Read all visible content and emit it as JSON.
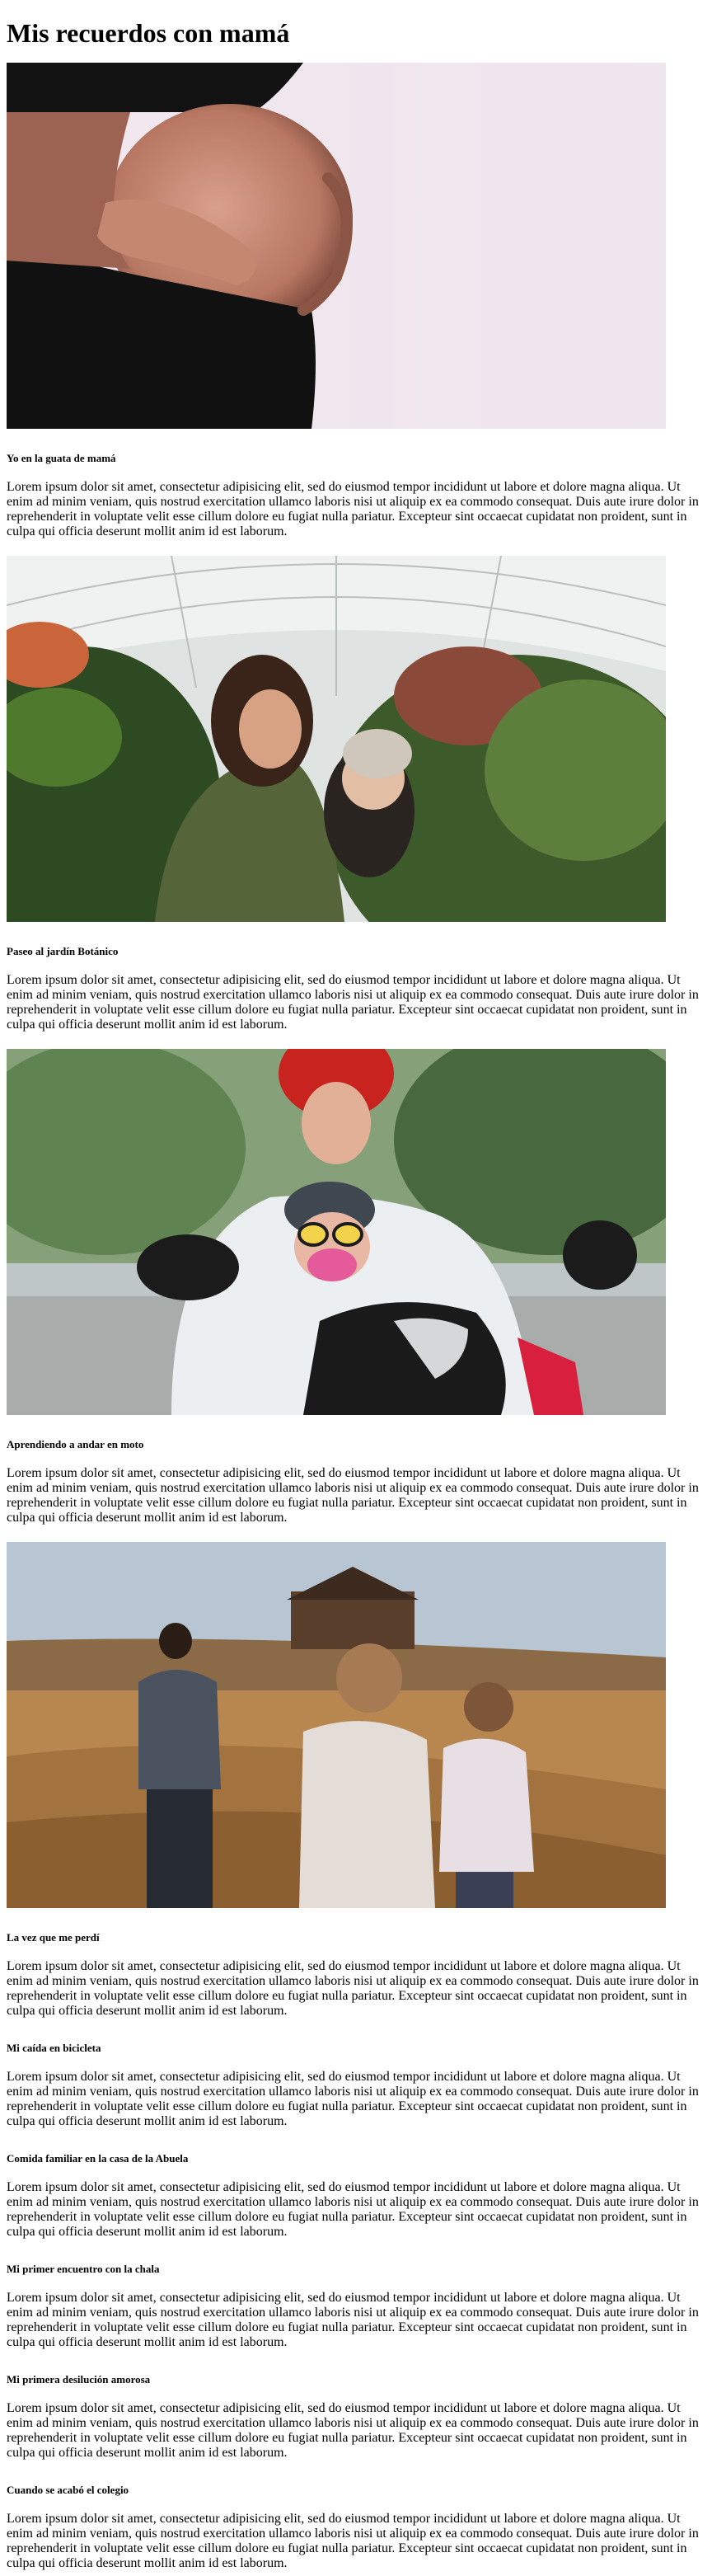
{
  "page": {
    "title": "Mis recuerdos con mamá"
  },
  "sections": [
    {
      "image_alt": "pregnant belly",
      "caption": "Yo en la guata de mamá",
      "text": "Lorem ipsum dolor sit amet, consectetur adipisicing elit, sed do eiusmod tempor incididunt ut labore et dolore magna aliqua. Ut enim ad minim veniam, quis nostrud exercitation ullamco laboris nisi ut aliquip ex ea commodo consequat. Duis aute irure dolor in reprehenderit in voluptate velit esse cillum dolore eu fugiat nulla pariatur. Excepteur sint occaecat cupidatat non proident, sunt in culpa qui officia deserunt mollit anim id est laborum."
    },
    {
      "image_alt": "mother and baby in greenhouse",
      "caption": "Paseo al jardín Botánico",
      "text": "Lorem ipsum dolor sit amet, consectetur adipisicing elit, sed do eiusmod tempor incididunt ut labore et dolore magna aliqua. Ut enim ad minim veniam, quis nostrud exercitation ullamco laboris nisi ut aliquip ex ea commodo consequat. Duis aute irure dolor in reprehenderit in voluptate velit esse cillum dolore eu fugiat nulla pariatur. Excepteur sint occaecat cupidatat non proident, sunt in culpa qui officia deserunt mollit anim id est laborum."
    },
    {
      "image_alt": "mother and child on motorcycle",
      "caption": "Aprendiendo a andar en moto",
      "text": "Lorem ipsum dolor sit amet, consectetur adipisicing elit, sed do eiusmod tempor incididunt ut labore et dolore magna aliqua. Ut enim ad minim veniam, quis nostrud exercitation ullamco laboris nisi ut aliquip ex ea commodo consequat. Duis aute irure dolor in reprehenderit in voluptate velit esse cillum dolore eu fugiat nulla pariatur. Excepteur sint occaecat cupidatat non proident, sunt in culpa qui officia deserunt mollit anim id est laborum."
    },
    {
      "image_alt": "family walking in field",
      "caption": "La vez que me perdí",
      "text": "Lorem ipsum dolor sit amet, consectetur adipisicing elit, sed do eiusmod tempor incididunt ut labore et dolore magna aliqua. Ut enim ad minim veniam, quis nostrud exercitation ullamco laboris nisi ut aliquip ex ea commodo consequat. Duis aute irure dolor in reprehenderit in voluptate velit esse cillum dolore eu fugiat nulla pariatur. Excepteur sint occaecat cupidatat non proident, sunt in culpa qui officia deserunt mollit anim id est laborum."
    }
  ],
  "text_sections": [
    {
      "caption": "Mi caída en bicicleta",
      "text": "Lorem ipsum dolor sit amet, consectetur adipisicing elit, sed do eiusmod tempor incididunt ut labore et dolore magna aliqua. Ut enim ad minim veniam, quis nostrud exercitation ullamco laboris nisi ut aliquip ex ea commodo consequat. Duis aute irure dolor in reprehenderit in voluptate velit esse cillum dolore eu fugiat nulla pariatur. Excepteur sint occaecat cupidatat non proident, sunt in culpa qui officia deserunt mollit anim id est laborum."
    },
    {
      "caption": "Comida familiar en la casa de la Abuela",
      "text": "Lorem ipsum dolor sit amet, consectetur adipisicing elit, sed do eiusmod tempor incididunt ut labore et dolore magna aliqua. Ut enim ad minim veniam, quis nostrud exercitation ullamco laboris nisi ut aliquip ex ea commodo consequat. Duis aute irure dolor in reprehenderit in voluptate velit esse cillum dolore eu fugiat nulla pariatur. Excepteur sint occaecat cupidatat non proident, sunt in culpa qui officia deserunt mollit anim id est laborum."
    },
    {
      "caption": "Mi primer encuentro con la chala",
      "text": "Lorem ipsum dolor sit amet, consectetur adipisicing elit, sed do eiusmod tempor incididunt ut labore et dolore magna aliqua. Ut enim ad minim veniam, quis nostrud exercitation ullamco laboris nisi ut aliquip ex ea commodo consequat. Duis aute irure dolor in reprehenderit in voluptate velit esse cillum dolore eu fugiat nulla pariatur. Excepteur sint occaecat cupidatat non proident, sunt in culpa qui officia deserunt mollit anim id est laborum."
    },
    {
      "caption": "Mi primera desilución amorosa",
      "text": "Lorem ipsum dolor sit amet, consectetur adipisicing elit, sed do eiusmod tempor incididunt ut labore et dolore magna aliqua. Ut enim ad minim veniam, quis nostrud exercitation ullamco laboris nisi ut aliquip ex ea commodo consequat. Duis aute irure dolor in reprehenderit in voluptate velit esse cillum dolore eu fugiat nulla pariatur. Excepteur sint occaecat cupidatat non proident, sunt in culpa qui officia deserunt mollit anim id est laborum."
    },
    {
      "caption": "Cuando se acabó el colegio",
      "text": "Lorem ipsum dolor sit amet, consectetur adipisicing elit, sed do eiusmod tempor incididunt ut labore et dolore magna aliqua. Ut enim ad minim veniam, quis nostrud exercitation ullamco laboris nisi ut aliquip ex ea commodo consequat. Duis aute irure dolor in reprehenderit in voluptate velit esse cillum dolore eu fugiat nulla pariatur. Excepteur sint occaecat cupidatat non proident, sunt in culpa qui officia deserunt mollit anim id est laborum."
    }
  ]
}
